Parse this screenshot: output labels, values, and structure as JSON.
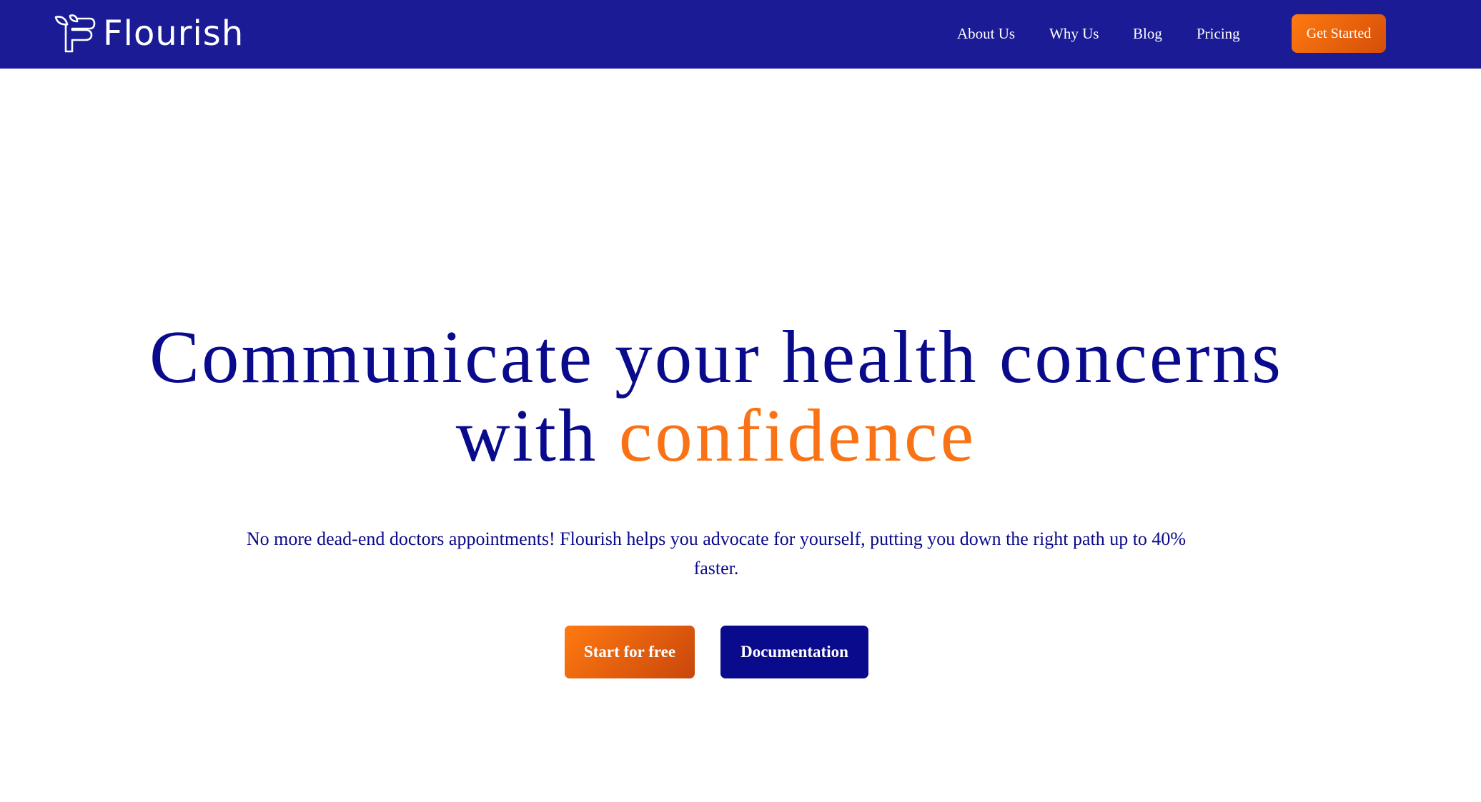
{
  "brand": {
    "name": "Flourish",
    "logo_icon": "leaf-f-logo-icon"
  },
  "nav": {
    "links": [
      {
        "label": "About Us"
      },
      {
        "label": "Why Us"
      },
      {
        "label": "Blog"
      },
      {
        "label": "Pricing"
      }
    ],
    "cta_label": "Get Started"
  },
  "hero": {
    "title_line1": "Communicate your health concerns",
    "title_line2_prefix": "with",
    "title_accent": "confidence",
    "subtitle": "No more dead-end doctors appointments! Flourish helps you advocate for yourself, putting you down the right path up to 40% faster.",
    "primary_cta": "Start for free",
    "secondary_cta": "Documentation"
  },
  "colors": {
    "nav_background": "#1b1b96",
    "primary_text": "#0a0a8c",
    "accent_orange": "#f97316",
    "button_dark": "#0a0a8c",
    "white": "#ffffff"
  }
}
